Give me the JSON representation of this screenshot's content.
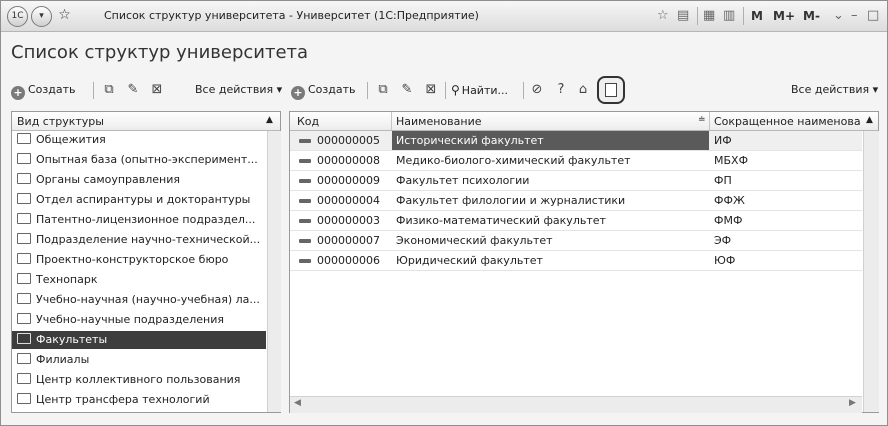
{
  "window": {
    "title": "Список структур университета - Университет  (1С:Предприятие)",
    "right_buttons": [
      "M",
      "M+",
      "M-"
    ]
  },
  "page": {
    "title": "Список структур университета"
  },
  "left_toolbar": {
    "create_label": "Создать",
    "all_actions_label": "Все действия ▾"
  },
  "right_toolbar": {
    "create_label": "Создать",
    "find_label": "Найти...",
    "all_actions_label": "Все действия ▾"
  },
  "left_list": {
    "header": "Вид структуры",
    "items": [
      "Общежития",
      "Опытная база (опытно-эксперимент...",
      "Органы самоуправления",
      "Отдел аспирантуры и докторантуры",
      "Патентно-лицензионное подраздел...",
      "Подразделение научно-технической...",
      "Проектно-конструкторское бюро",
      "Технопарк",
      "Учебно-научная (научно-учебная) ла...",
      "Учебно-научные подразделения",
      "Факультеты",
      "Филиалы",
      "Центр коллективного пользования",
      "Центр трансфера технологий"
    ],
    "selected_index": 10
  },
  "table": {
    "columns": [
      "Код",
      "Наименование",
      "Сокращенное наименова"
    ],
    "rows": [
      {
        "code": "000000005",
        "name": "Исторический факультет",
        "short": "ИФ"
      },
      {
        "code": "000000008",
        "name": "Медико-биолого-химический факультет",
        "short": "МБХФ"
      },
      {
        "code": "000000009",
        "name": "Факультет психологии",
        "short": "ФП"
      },
      {
        "code": "000000004",
        "name": "Факультет филологии и журналистики",
        "short": "ФФЖ"
      },
      {
        "code": "000000003",
        "name": "Физико-математический факультет",
        "short": "ФМФ"
      },
      {
        "code": "000000007",
        "name": "Экономический факультет",
        "short": "ЭФ"
      },
      {
        "code": "000000006",
        "name": "Юридический факультет",
        "short": "ЮФ"
      }
    ],
    "selected_index": 0
  }
}
